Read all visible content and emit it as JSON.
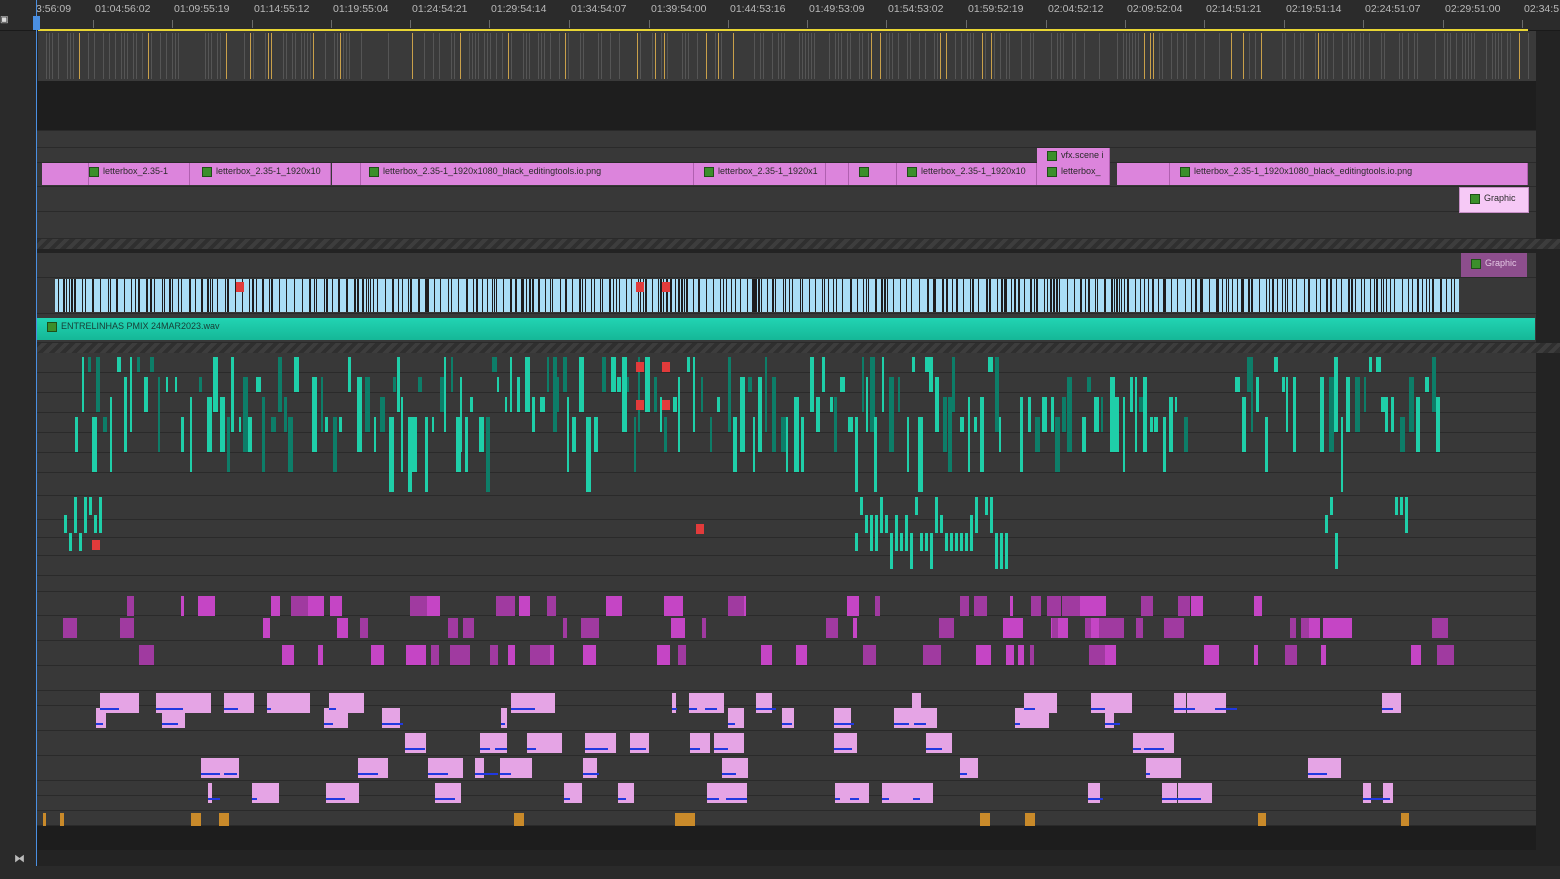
{
  "ruler": {
    "timecodes": [
      "3:56:09",
      "01:04:56:02",
      "01:09:55:19",
      "01:14:55:12",
      "01:19:55:04",
      "01:24:54:21",
      "01:29:54:14",
      "01:34:54:07",
      "01:39:54:00",
      "01:44:53:16",
      "01:49:53:09",
      "01:54:53:02",
      "01:59:52:19",
      "02:04:52:12",
      "02:09:52:04",
      "02:14:51:21",
      "02:19:51:14",
      "02:24:51:07",
      "02:29:51:00",
      "02:34:5"
    ]
  },
  "clips": {
    "v_letterbox_1": "letterbox_2.35-1",
    "v_letterbox_2": "letterbox_2.35-1_1920x10",
    "v_letterbox_3": "letterbox_2.35-1_1920x1080_black_editingtools.io.png",
    "v_letterbox_4": "letterbox_2.35-1_1920x1",
    "v_letterbox_5": "letterbox_2.35-1_1920x10",
    "v_vfx": "vfx.scene i",
    "v_letterbox_6": "letterbox_",
    "v_letterbox_7": "letterbox_2.35-1_1920x1080_black_editingtools.io.png",
    "graphic_1": "Graphic",
    "graphic_2": "Graphic",
    "audio_master": "ENTRELINHAS PMIX 24MAR2023.wav"
  },
  "colors": {
    "video_graphic": "#dc84dc",
    "video_clip": "#a9ddf5",
    "audio_teal": "#19c9a7",
    "audio_magenta": "#c545c5",
    "audio_light_magenta": "#e5a4e5",
    "audio_orange": "#c98a2a",
    "playhead": "#4a8fe2",
    "work_area": "#e8d534"
  },
  "icons": {
    "snap": "snap-icon",
    "fx": "fx-badge-icon",
    "settings": "sequence-settings-icon"
  }
}
